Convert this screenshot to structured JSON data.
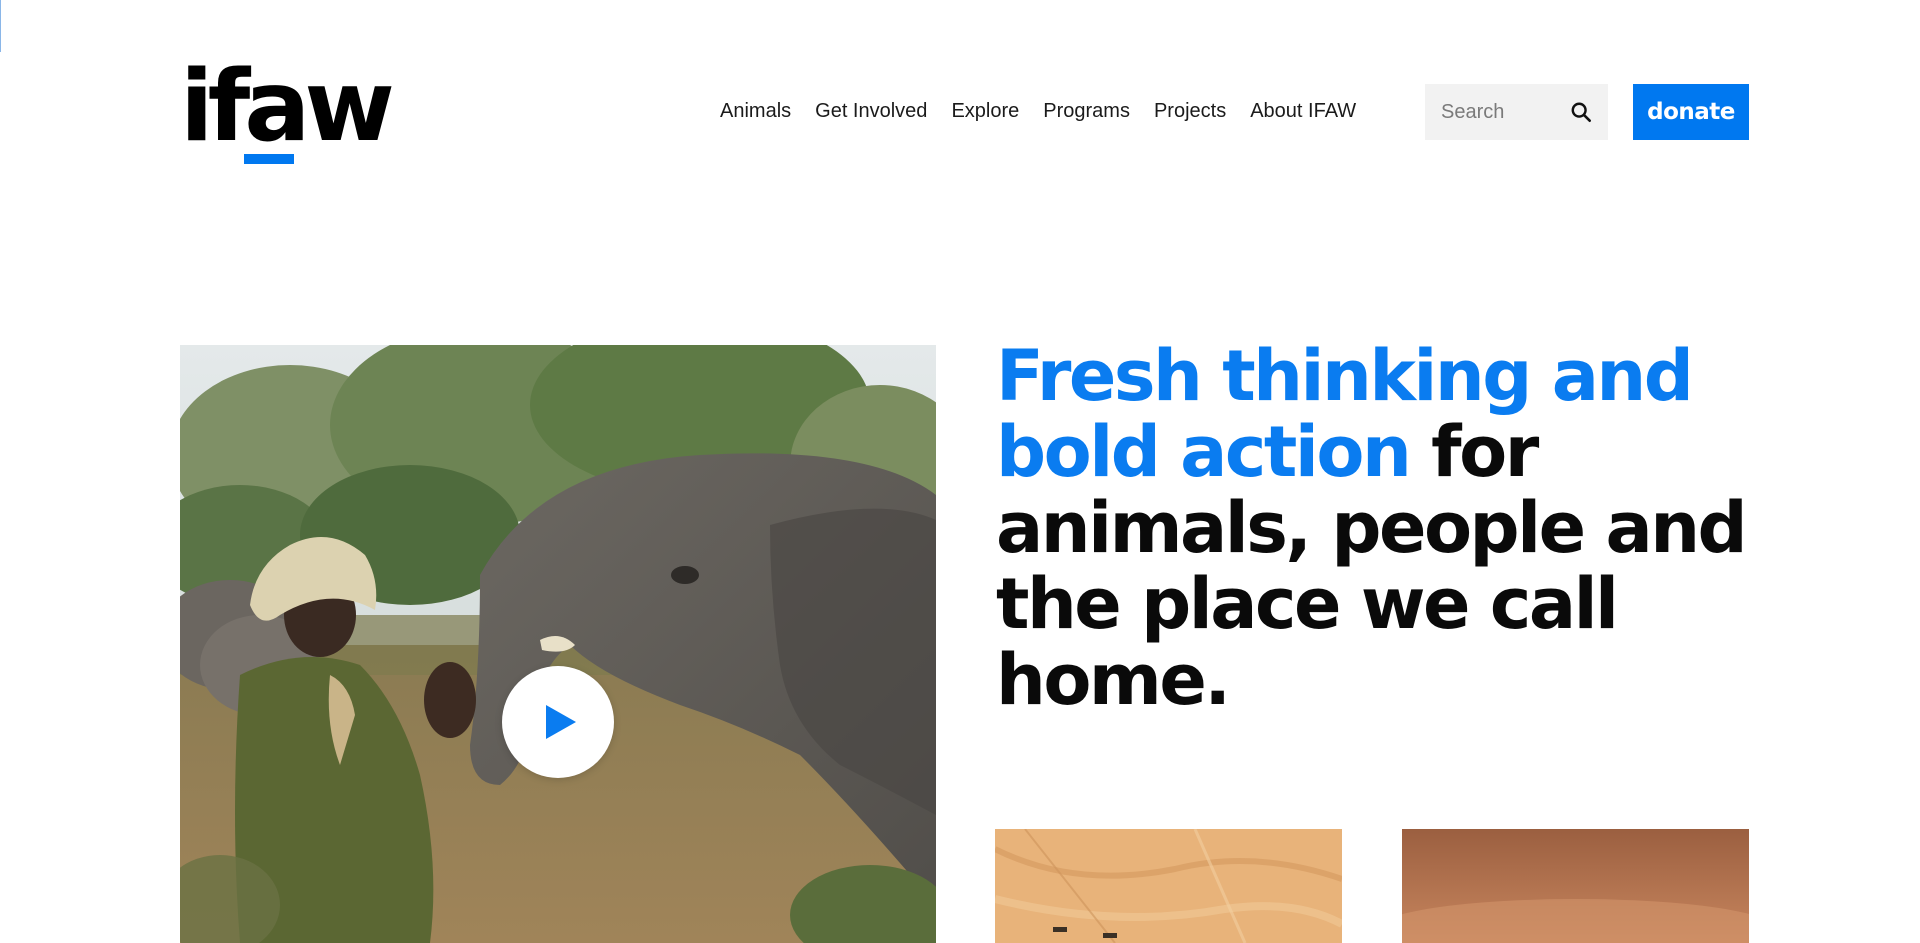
{
  "brand": {
    "logo_text": "ifaw",
    "accent_color": "#0078f0"
  },
  "nav": {
    "items": [
      {
        "label": "Animals"
      },
      {
        "label": "Get Involved"
      },
      {
        "label": "Explore"
      },
      {
        "label": "Programs"
      },
      {
        "label": "Projects"
      },
      {
        "label": "About IFAW"
      }
    ]
  },
  "search": {
    "placeholder": "Search",
    "icon": "search-icon"
  },
  "donate": {
    "label": "donate",
    "color": "#0078f0"
  },
  "hero": {
    "play_icon": "play-icon",
    "headline_accent": "Fresh thinking and bold action",
    "headline_rest": " for animals, people and the place we call home."
  }
}
